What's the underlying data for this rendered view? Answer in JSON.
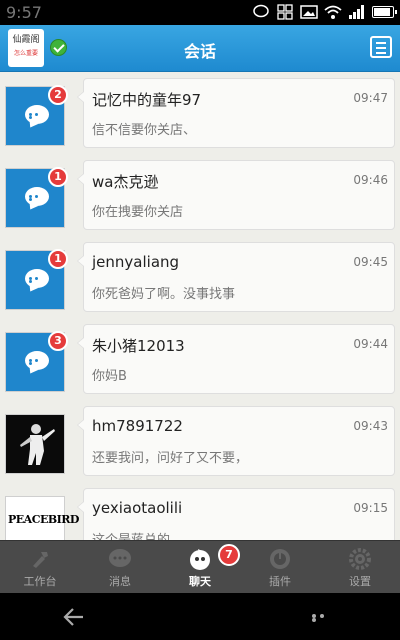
{
  "status": {
    "time": "9:57"
  },
  "header": {
    "title": "会话",
    "logo_text": "仙霞阁",
    "logo_sub": "怎么重要"
  },
  "conversations": [
    {
      "name": "记忆中的童年97",
      "time": "09:47",
      "message": "信不信要你关店、",
      "badge": "2",
      "avatar": "chat-bubble"
    },
    {
      "name": "wa杰克逊",
      "time": "09:46",
      "message": "你在拽要你关店",
      "badge": "1",
      "avatar": "chat-bubble"
    },
    {
      "name": "jennyaliang",
      "time": "09:45",
      "message": "你死爸妈了啊。没事找事",
      "badge": "1",
      "avatar": "chat-bubble"
    },
    {
      "name": "朱小猪12013",
      "time": "09:44",
      "message": "你妈B",
      "badge": "3",
      "avatar": "chat-bubble"
    },
    {
      "name": "hm7891722",
      "time": "09:43",
      "message": "还要我问，问好了又不要，",
      "badge": "",
      "avatar": "photo"
    },
    {
      "name": "yexiaotaolili",
      "time": "09:15",
      "message": "这个是蒋总的",
      "badge": "",
      "avatar": "brand",
      "brand_text": "PEACEBIRD"
    }
  ],
  "tabs": [
    {
      "label": "工作台",
      "icon": "workbench-icon"
    },
    {
      "label": "消息",
      "icon": "message-icon"
    },
    {
      "label": "聊天",
      "icon": "chat-icon",
      "active": true
    },
    {
      "label": "插件",
      "icon": "plugin-icon"
    },
    {
      "label": "设置",
      "icon": "settings-icon"
    }
  ],
  "chat_tab_badge": "7",
  "colors": {
    "header": "#2a97d8",
    "badge": "#e53b3b",
    "avatar_blue": "#1f86cc"
  }
}
